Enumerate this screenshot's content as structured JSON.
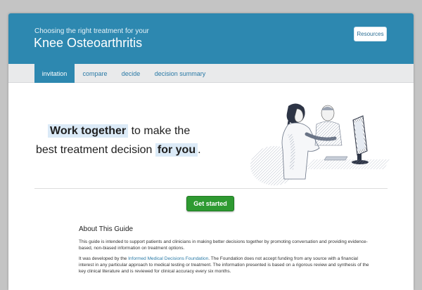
{
  "header": {
    "subtitle": "Choosing the right treatment for your",
    "title": "Knee Osteoarthritis",
    "resources_label": "Resources"
  },
  "nav": {
    "tabs": [
      {
        "label": "invitation",
        "active": true
      },
      {
        "label": "compare",
        "active": false
      },
      {
        "label": "decide",
        "active": false
      },
      {
        "label": "decision summary",
        "active": false
      }
    ]
  },
  "hero": {
    "line1_highlight": "Work together",
    "line1_rest": "to make the",
    "line2_start": "best treatment decision",
    "line2_highlight": "for you",
    "line2_end": "."
  },
  "cta": {
    "label": "Get started"
  },
  "about": {
    "title": "About This Guide",
    "para1": "This guide is intended to support patients and clinicians in making better decisions together by promoting conversation and providing evidence-based, non-biased information on treatment options.",
    "para2_prefix": "It was developed by the",
    "para2_link": "Informed Medical Decisions Foundation",
    "para2_suffix": ". The Foundation does not accept funding from any source with a financial interest in any particular approach to medical testing or treatment. The information presented is based on a rigorous review and synthesis of the key clinical literature and is reviewed for clinical accuracy every six months."
  },
  "colors": {
    "header_blue": "#2d88b0",
    "link_blue": "#2a7aa6",
    "cta_green": "#2e9a31",
    "highlight": "#dbeaf7"
  }
}
